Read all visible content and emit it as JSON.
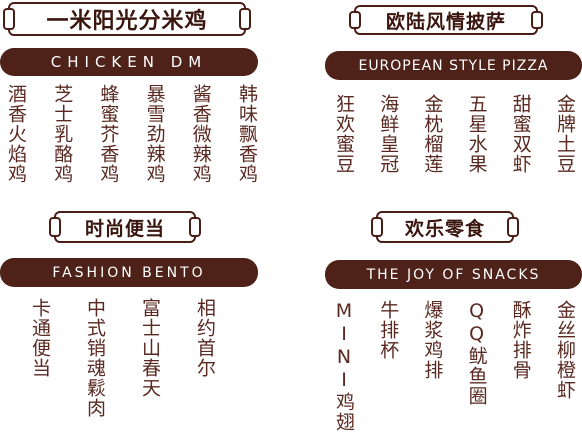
{
  "sections": [
    {
      "title": "一米阳光分米鸡",
      "banner": "CHICKEN    DM",
      "items": [
        "酒香火焰鸡",
        "芝士乳酪鸡",
        "蜂蜜芥香鸡",
        "暴雪劲辣鸡",
        "酱香微辣鸡",
        "韩味飘香鸡"
      ]
    },
    {
      "title": "欧陆风情披萨",
      "banner": "EUROPEAN STYLE PIZZA",
      "items": [
        "狂欢蜜豆",
        "海鲜皇冠",
        "金枕榴莲",
        "五星水果",
        "甜蜜双虾",
        "金牌土豆"
      ]
    },
    {
      "title": "时尚便当",
      "banner": "FASHION BENTO",
      "items": [
        "卡通便当",
        "中式销魂鬏肉",
        "富士山春天",
        "相约首尔"
      ]
    },
    {
      "title": "欢乐零食",
      "banner": "THE  JOY OF  SNACKS",
      "items": [
        "MINI鸡翅",
        "牛排杯",
        "爆浆鸡排",
        "QQ鱿鱼圈",
        "酥炸排骨",
        "金丝柳橙虾"
      ]
    }
  ]
}
